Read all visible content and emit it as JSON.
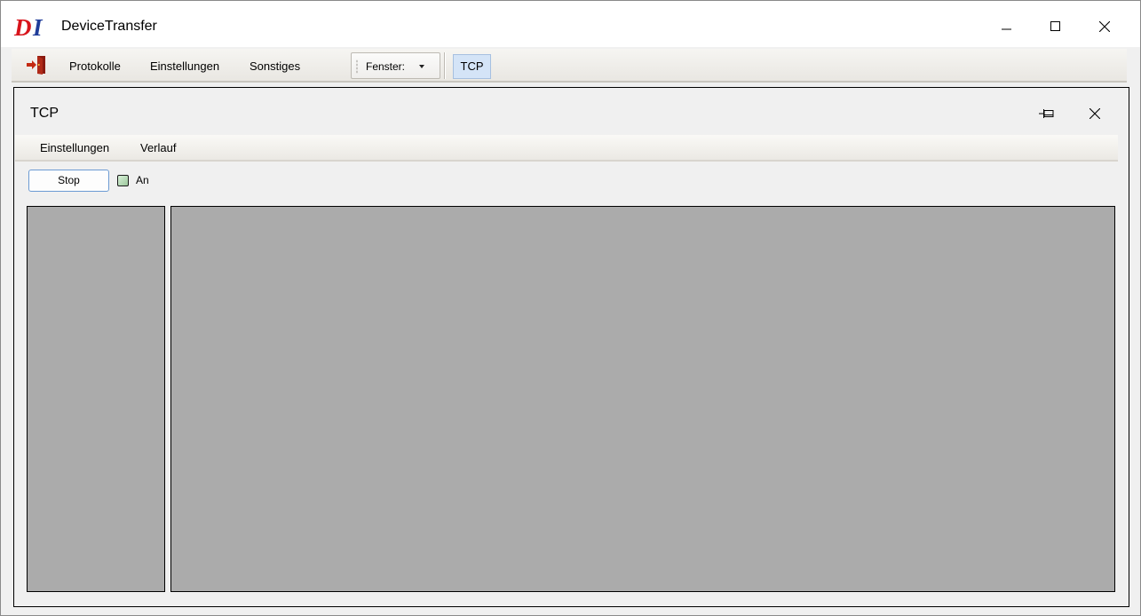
{
  "window": {
    "logo_text": "DI",
    "title": "DeviceTransfer",
    "brand_colors": {
      "logo_red": "#d8141c",
      "logo_blue": "#1f3c99"
    }
  },
  "menubar": {
    "exit_icon": "exit-door-icon",
    "items": [
      {
        "label": "Protokolle"
      },
      {
        "label": "Einstellungen"
      },
      {
        "label": "Sonstiges"
      }
    ],
    "fenster_label": "Fenster:",
    "active_tab": "TCP"
  },
  "child_window": {
    "title": "TCP",
    "menu": [
      {
        "label": "Einstellungen"
      },
      {
        "label": "Verlauf"
      }
    ],
    "stop_button": "Stop",
    "checkbox_label": "An",
    "checkbox_checked": false,
    "panel_color": "#ababab"
  }
}
